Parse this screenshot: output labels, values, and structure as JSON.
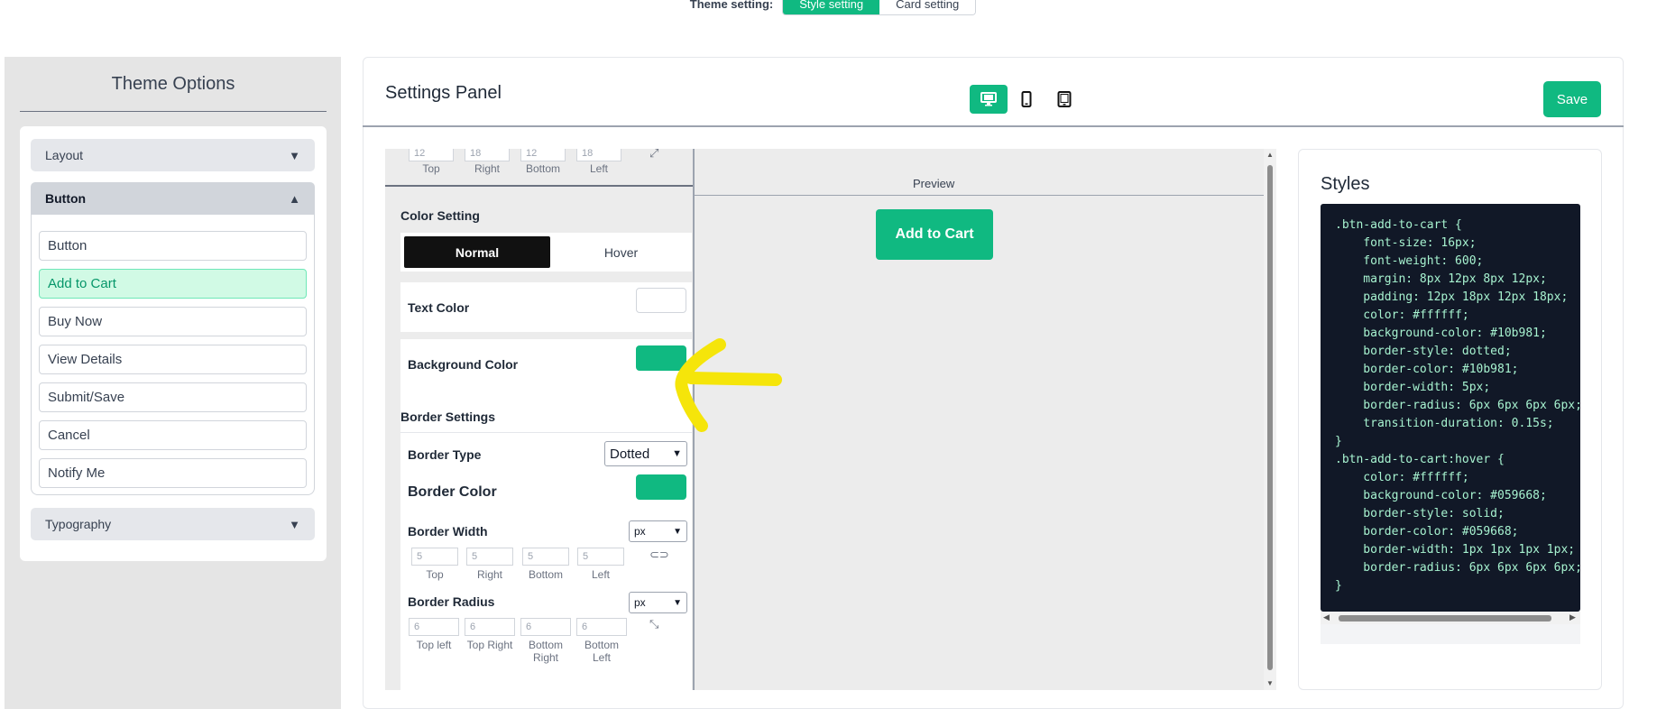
{
  "top_toggle": {
    "label": "Theme setting:",
    "options": [
      "Style setting",
      "Card setting"
    ],
    "active": "Style setting"
  },
  "sidebar": {
    "title": "Theme Options",
    "sections": {
      "layout": "Layout",
      "button": "Button",
      "typography": "Typography"
    },
    "button_items": [
      "Button",
      "Add to Cart",
      "Buy Now",
      "View Details",
      "Submit/Save",
      "Cancel",
      "Notify Me"
    ],
    "active_item": "Add to Cart"
  },
  "panel": {
    "title": "Settings Panel",
    "devices": [
      "desktop-icon",
      "mobile-icon",
      "tablet-icon"
    ],
    "active_device": "desktop",
    "save_label": "Save"
  },
  "controls": {
    "margin": {
      "values": [
        "12",
        "18",
        "12",
        "18"
      ],
      "labels": [
        "Top",
        "Right",
        "Bottom",
        "Left"
      ]
    },
    "color_setting": {
      "title": "Color Setting",
      "tabs": [
        "Normal",
        "Hover"
      ],
      "active_tab": "Normal"
    },
    "text_color": {
      "label": "Text Color",
      "value": "#ffffff"
    },
    "background_color": {
      "label": "Background Color",
      "value": "#10b981"
    },
    "border": {
      "title": "Border Settings",
      "type_label": "Border Type",
      "type_value": "Dotted",
      "color_label": "Border Color",
      "color_value": "#10b981",
      "width_label": "Border Width",
      "width_unit": "px",
      "width_values": [
        "5",
        "5",
        "5",
        "5"
      ],
      "width_labels": [
        "Top",
        "Right",
        "Bottom",
        "Left"
      ],
      "radius_label": "Border Radius",
      "radius_unit": "px",
      "radius_values": [
        "6",
        "6",
        "6",
        "6"
      ],
      "radius_labels": [
        "Top left",
        "Top Right",
        "Bottom Right",
        "Bottom Left"
      ]
    }
  },
  "preview": {
    "label": "Preview",
    "button_label": "Add to Cart"
  },
  "styles": {
    "title": "Styles",
    "code": ".btn-add-to-cart {\n    font-size: 16px;\n    font-weight: 600;\n    margin: 8px 12px 8px 12px;\n    padding: 12px 18px 12px 18px;\n    color: #ffffff;\n    background-color: #10b981;\n    border-style: dotted;\n    border-color: #10b981;\n    border-width: 5px;\n    border-radius: 6px 6px 6px 6px;\n    transition-duration: 0.15s;\n}\n.btn-add-to-cart:hover {\n    color: #ffffff;\n    background-color: #059668;\n    border-style: solid;\n    border-color: #059668;\n    border-width: 1px 1px 1px 1px;\n    border-radius: 6px 6px 6px 6px;\n}"
  },
  "colors": {
    "accent": "#10b981",
    "annotation": "#f5e50a"
  }
}
